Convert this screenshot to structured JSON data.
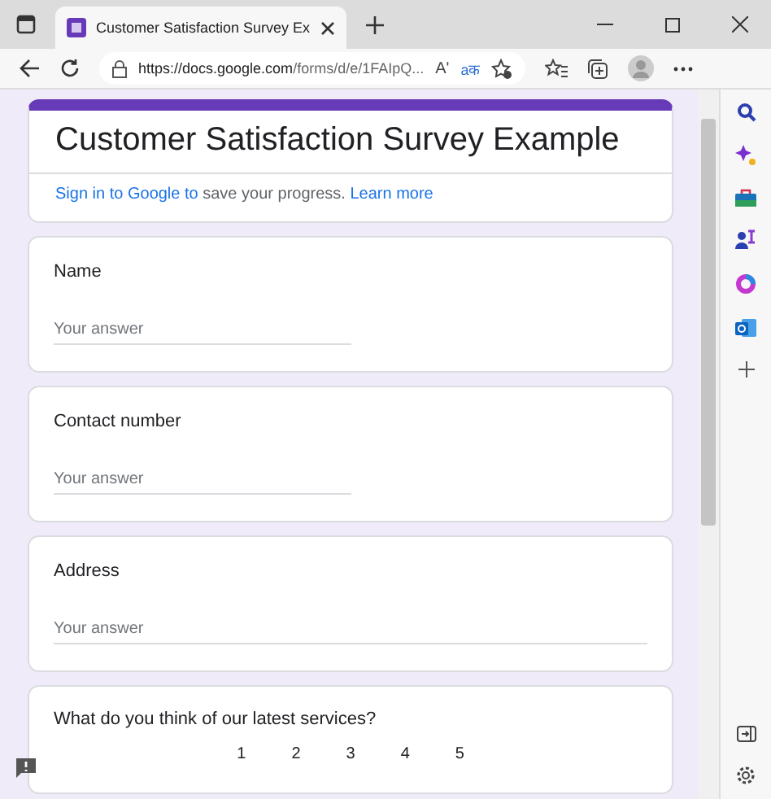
{
  "browser": {
    "tab_title": "Customer Satisfaction Survey Ex",
    "url_host": "https://docs.google.com",
    "url_path": "/forms/d/e/1FAIpQ...",
    "read_aloud": "Aʹ",
    "translate": "aक"
  },
  "form": {
    "title": "Customer Satisfaction Survey Example",
    "signin_link": "Sign in to Google to",
    "signin_text": " save your progress. ",
    "learn_more": "Learn more"
  },
  "questions": [
    {
      "label": "Name",
      "kind": "short",
      "placeholder": "Your answer"
    },
    {
      "label": "Contact number",
      "kind": "short",
      "placeholder": "Your answer"
    },
    {
      "label": "Address",
      "kind": "long",
      "placeholder": "Your answer"
    },
    {
      "label": "What do you think of our latest services?",
      "kind": "scale",
      "scale": [
        "1",
        "2",
        "3",
        "4",
        "5"
      ]
    }
  ]
}
